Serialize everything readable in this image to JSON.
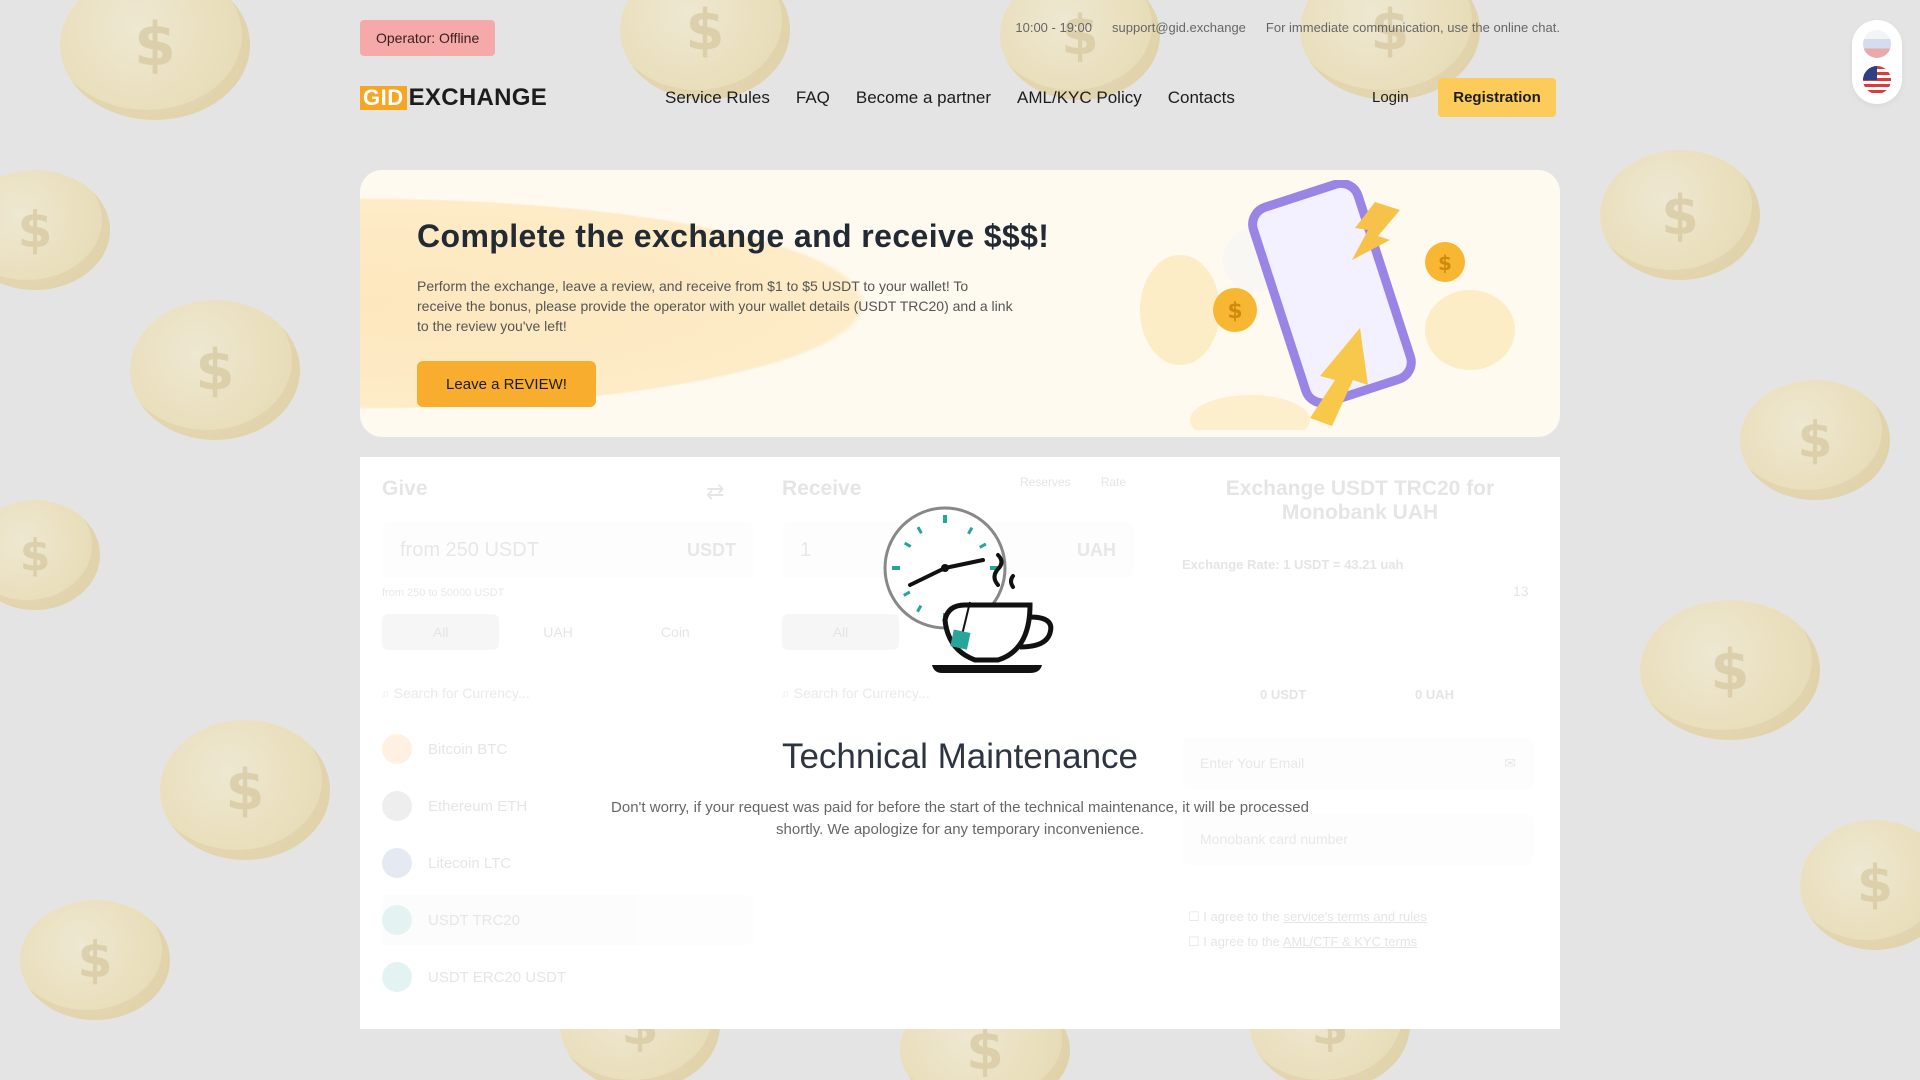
{
  "topbar": {
    "operator_status": "Operator: Offline",
    "hours": "10:00 - 19:00",
    "email": "support@gid.exchange",
    "chat_note": "For immediate communication, use the online chat."
  },
  "header": {
    "logo_part1": "GID",
    "logo_part2": "EXCHANGE",
    "nav": [
      "Service Rules",
      "FAQ",
      "Become a partner",
      "AML/KYC Policy",
      "Contacts"
    ],
    "login": "Login",
    "register": "Registration"
  },
  "language_switcher": [
    "ru-flag-icon",
    "us-flag-icon"
  ],
  "banner": {
    "title": "Complete the exchange and receive $$$!",
    "text": "Perform the exchange, leave a review, and receive from $1 to $5 USDT to your wallet! To receive the bonus, please provide the operator with your wallet details (USDT TRC20) and a link to the review you've left!",
    "button": "Leave a REVIEW!"
  },
  "exchange": {
    "give": {
      "title": "Give",
      "amount_placeholder": "from 250 USDT",
      "currency": "USDT",
      "limits": "from 250 to 50000 USDT",
      "tabs": [
        "All",
        "UAH",
        "Coin"
      ],
      "search_placeholder": "Search for Currency...",
      "currencies": [
        "Bitcoin BTC",
        "Ethereum ETH",
        "Litecoin LTC",
        "USDT TRC20",
        "USDT ERC20 USDT"
      ],
      "selected": "USDT TRC20"
    },
    "receive": {
      "title": "Receive",
      "toggle": [
        "Reserves",
        "Rate"
      ],
      "amount": "1",
      "currency": "UAH",
      "tabs": [
        "All"
      ],
      "search_placeholder": "Search for Currency..."
    },
    "summary": {
      "title": "Exchange USDT TRC20 for Monobank UAH",
      "rate": "Exchange Rate: 1 USDT = 43.21 uah",
      "timer": "13",
      "from_amount": "0 USDT",
      "to_amount": "0 UAH",
      "email_placeholder": "Enter Your Email",
      "card_placeholder": "Monobank card number",
      "agree_prefix": "I agree to the",
      "terms_link": "service's terms and rules",
      "aml_link": "AML/CTF & KYC terms"
    }
  },
  "maintenance": {
    "title": "Technical Maintenance",
    "text": "Don't worry, if your request was paid for before the start of the technical maintenance, it will be processed shortly. We apologize for any temporary inconvenience."
  },
  "colors": {
    "accent": "#f8ad2e",
    "register": "#fccb5a",
    "operator_offline": "#f5a9a9",
    "teal": "#26a69a"
  }
}
